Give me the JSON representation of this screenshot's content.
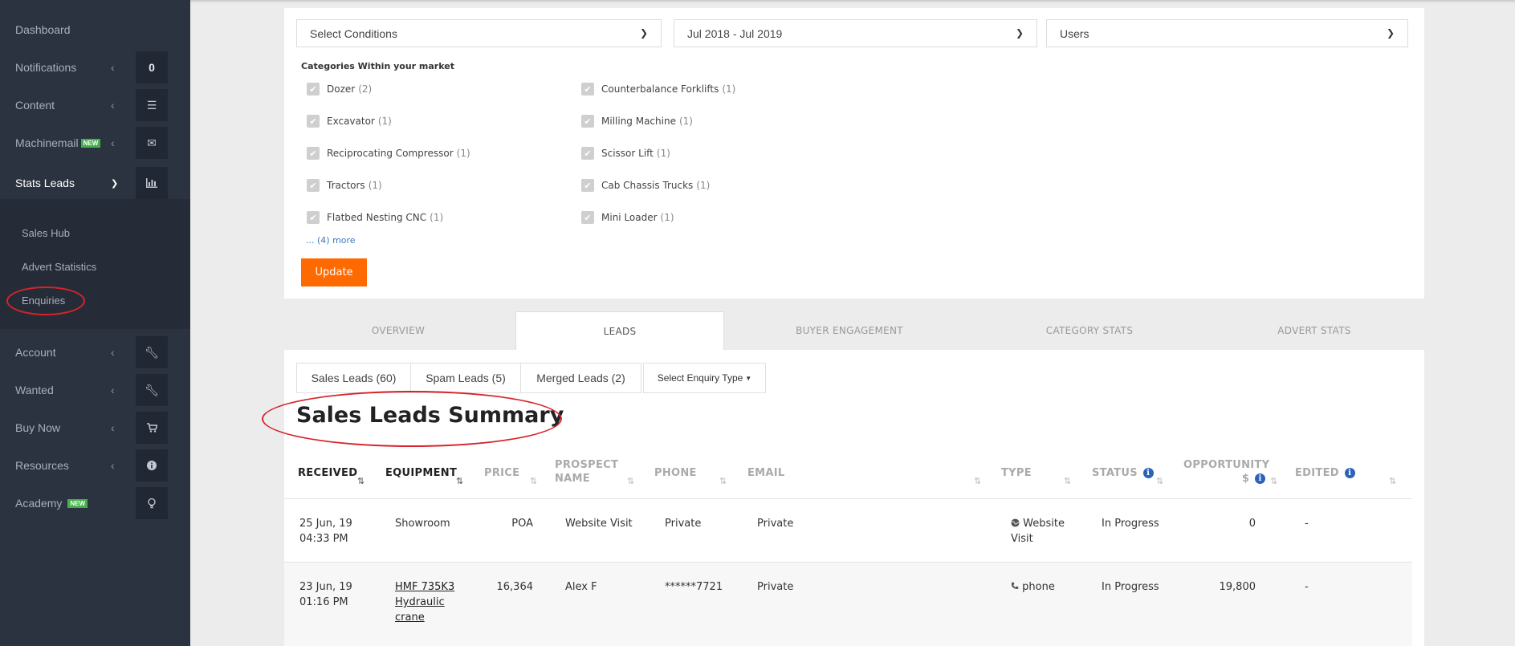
{
  "sidebar": {
    "items": [
      {
        "label": "Dashboard"
      },
      {
        "label": "Notifications",
        "count": "0"
      },
      {
        "label": "Content"
      },
      {
        "label": "Machinemail",
        "badge": "NEW"
      },
      {
        "label": "Stats Leads"
      },
      {
        "label": "Account"
      },
      {
        "label": "Wanted"
      },
      {
        "label": "Buy Now"
      },
      {
        "label": "Resources"
      },
      {
        "label": "Academy",
        "badge": "NEW"
      }
    ],
    "submenu": [
      "Sales Hub",
      "Advert Statistics",
      "Enquiries"
    ]
  },
  "filters": {
    "conditions": "Select Conditions",
    "date_range": "Jul 2018 - Jul 2019",
    "users": "Users",
    "categories_heading": "Categories Within your market",
    "categories": [
      {
        "name": "Dozer",
        "count": "(2)"
      },
      {
        "name": "Excavator",
        "count": "(1)"
      },
      {
        "name": "Reciprocating Compressor",
        "count": "(1)"
      },
      {
        "name": "Tractors",
        "count": "(1)"
      },
      {
        "name": "Flatbed Nesting CNC",
        "count": "(1)"
      },
      {
        "name": "Counterbalance Forklifts",
        "count": "(1)"
      },
      {
        "name": "Milling Machine",
        "count": "(1)"
      },
      {
        "name": "Scissor Lift",
        "count": "(1)"
      },
      {
        "name": "Cab Chassis Trucks",
        "count": "(1)"
      },
      {
        "name": "Mini Loader",
        "count": "(1)"
      }
    ],
    "more": "... (4) more",
    "update": "Update"
  },
  "tabs": [
    "OVERVIEW",
    "LEADS",
    "BUYER ENGAGEMENT",
    "CATEGORY STATS",
    "ADVERT STATS"
  ],
  "subtabs": [
    "Sales Leads (60)",
    "Spam Leads (5)",
    "Merged Leads (2)"
  ],
  "enquiry_type": "Select Enquiry Type",
  "summary_title": "Sales Leads Summary",
  "table": {
    "headers": {
      "received": "RECEIVED",
      "equipment": "EQUIPMENT",
      "price": "PRICE",
      "prospect1": "PROSPECT",
      "prospect2": "NAME",
      "phone": "PHONE",
      "email": "EMAIL",
      "type": "TYPE",
      "status": "STATUS",
      "opportunity1": "OPPORTUNITY",
      "opportunity2": "$",
      "edited": "EDITED"
    },
    "rows": [
      {
        "date": "25 Jun, 19",
        "time": "04:33 PM",
        "equipment1": "Showroom",
        "equipment2": "",
        "equipment3": "",
        "price": "POA",
        "prospect": "Website Visit",
        "phone": "Private",
        "email": "Private",
        "type1": "Website",
        "type2": "Visit",
        "status": "In Progress",
        "opportunity": "0",
        "edited": "-"
      },
      {
        "date": "23 Jun, 19",
        "time": "01:16 PM",
        "equipment1": "HMF 735K3",
        "equipment2": "Hydraulic",
        "equipment3": "crane",
        "price": "16,364",
        "prospect": "Alex F",
        "phone": "******7721",
        "email": "Private",
        "type1": "phone",
        "type2": "",
        "status": "In Progress",
        "opportunity": "19,800",
        "edited": "-"
      }
    ]
  }
}
